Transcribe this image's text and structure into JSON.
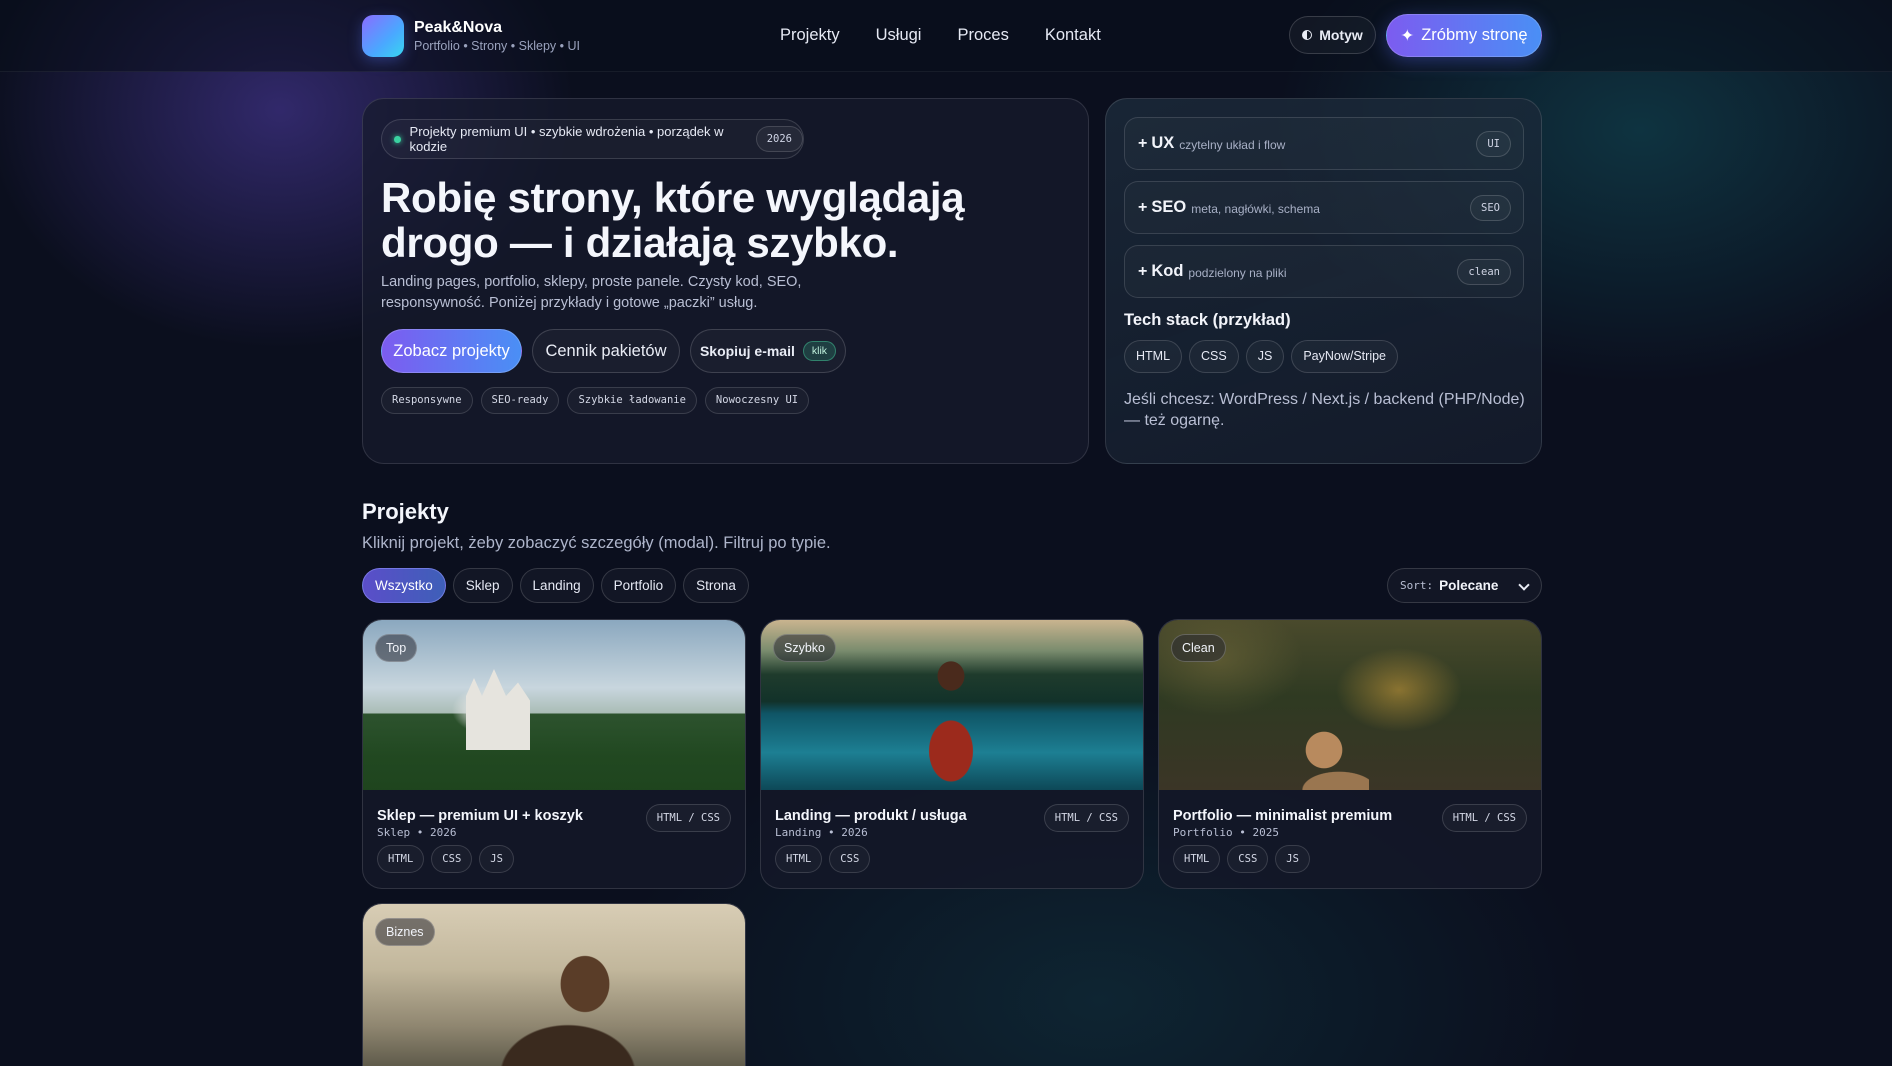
{
  "brand": {
    "name": "Peak&Nova",
    "tagline": "Portfolio • Strony • Sklepy • UI"
  },
  "nav": {
    "items": [
      "Projekty",
      "Usługi",
      "Proces",
      "Kontakt"
    ]
  },
  "header_actions": {
    "theme_label": "Motyw",
    "cta_label": "Zróbmy stronę",
    "cta_icon": "✦"
  },
  "hero": {
    "pill_text": "Projekty premium UI • szybkie wdrożenia • porządek w kodzie",
    "pill_year": "2026",
    "title": "Robię strony, które wyglądają drogo — i działają szybko.",
    "lead": "Landing pages, portfolio, sklepy, proste panele. Czysty kod, SEO, responsywność. Poniżej przykłady i gotowe „paczki” usług.",
    "btn_primary": "Zobacz projekty",
    "btn_pricing": "Cennik pakietów",
    "btn_copy": "Skopiuj e-mail",
    "btn_copy_badge": "klik",
    "tags": [
      "Responsywne",
      "SEO-ready",
      "Szybkie ładowanie",
      "Nowoczesny UI"
    ]
  },
  "side": {
    "features": [
      {
        "plus": "+",
        "title": "UX",
        "desc": "czytelny układ i flow",
        "code": "UI"
      },
      {
        "plus": "+",
        "title": "SEO",
        "desc": "meta, nagłówki, schema",
        "code": "SEO"
      },
      {
        "plus": "+",
        "title": "Kod",
        "desc": "podzielony na pliki",
        "code": "clean"
      }
    ],
    "stack_title": "Tech stack (przykład)",
    "stack": [
      "HTML",
      "CSS",
      "JS",
      "PayNow/Stripe"
    ],
    "note": "Jeśli chcesz: WordPress / Next.js / backend (PHP/Node) — też ogarnę."
  },
  "projects": {
    "title": "Projekty",
    "subtitle": "Kliknij projekt, żeby zobaczyć szczegóły (modal). Filtruj po typie.",
    "filters": [
      "Wszystko",
      "Sklep",
      "Landing",
      "Portfolio",
      "Strona"
    ],
    "active_filter": "Wszystko",
    "sort_label": "Sort:",
    "sort_value": "Polecane",
    "cards": [
      {
        "badge": "Top",
        "title": "Sklep — premium UI + koszyk",
        "meta": "Sklep • 2026",
        "tech": "HTML / CSS",
        "tags": [
          "HTML",
          "CSS",
          "JS"
        ]
      },
      {
        "badge": "Szybko",
        "title": "Landing — produkt / usługa",
        "meta": "Landing • 2026",
        "tech": "HTML / CSS",
        "tags": [
          "HTML",
          "CSS"
        ]
      },
      {
        "badge": "Clean",
        "title": "Portfolio — minimalist premium",
        "meta": "Portfolio • 2025",
        "tech": "HTML / CSS",
        "tags": [
          "HTML",
          "CSS",
          "JS"
        ]
      },
      {
        "badge": "Biznes"
      }
    ]
  },
  "colors": {
    "background": "#0b0f1e",
    "accent_start": "#7c5cf0",
    "accent_end": "#4a8ff5",
    "status_green": "#3ad1a0"
  }
}
